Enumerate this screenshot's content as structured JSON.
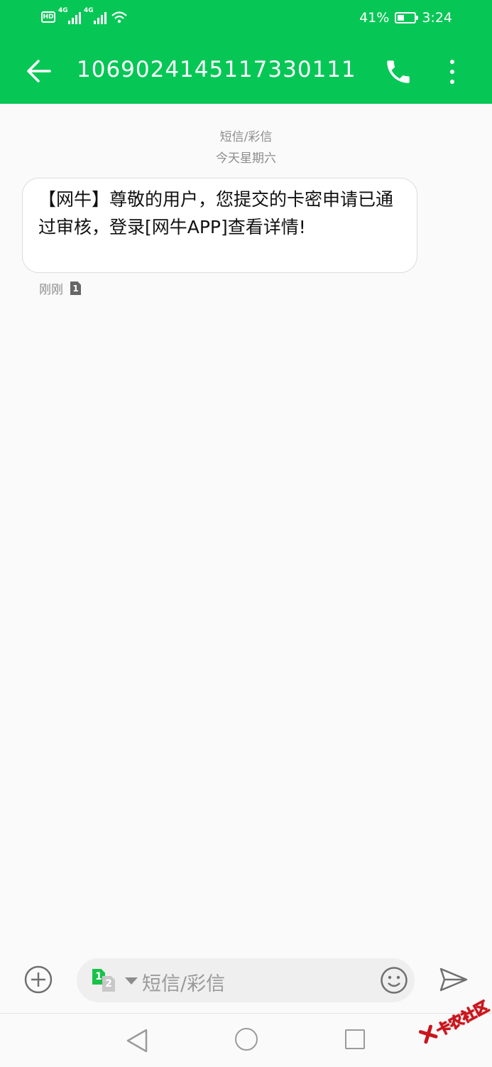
{
  "status_bar": {
    "hd_label": "HD",
    "network1": "4G",
    "network2": "4G",
    "battery_percent": "41%",
    "battery_level": 0.41,
    "time": "3:24"
  },
  "app_bar": {
    "title": "1069024145117330111",
    "icons": {
      "back": "arrow-left-icon",
      "call": "phone-icon",
      "more": "more-vert-icon"
    }
  },
  "thread": {
    "channel_label": "短信/彩信",
    "date_label": "今天星期六",
    "messages": [
      {
        "text": "【网牛】尊敬的用户，您提交的卡密申请已通过审核，登录[网牛APP]查看详情!",
        "time": "刚刚",
        "sim": "1"
      }
    ]
  },
  "composer": {
    "placeholder": "短信/彩信",
    "sim_primary": "1",
    "sim_secondary": "2",
    "icons": {
      "add": "add-circle-icon",
      "emoji": "emoji-icon",
      "send": "send-icon",
      "dropdown": "caret-down-icon"
    }
  },
  "watermark": {
    "text": "卡农社区"
  },
  "colors": {
    "accent": "#06c755",
    "sim_active": "#19c24a"
  }
}
